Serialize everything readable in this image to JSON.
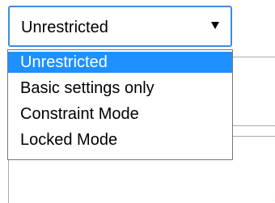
{
  "select": {
    "current_value": "Unrestricted",
    "arrow_icon": "caret-down-icon"
  },
  "dropdown": {
    "options": [
      {
        "label": "Unrestricted",
        "selected": true
      },
      {
        "label": "Basic settings only",
        "selected": false
      },
      {
        "label": "Constraint Mode",
        "selected": false
      },
      {
        "label": "Locked Mode",
        "selected": false
      }
    ]
  },
  "colors": {
    "focus_border": "#3c8be6",
    "selected_option_bg": "#1e90ff",
    "selected_option_text": "#ffffff"
  }
}
